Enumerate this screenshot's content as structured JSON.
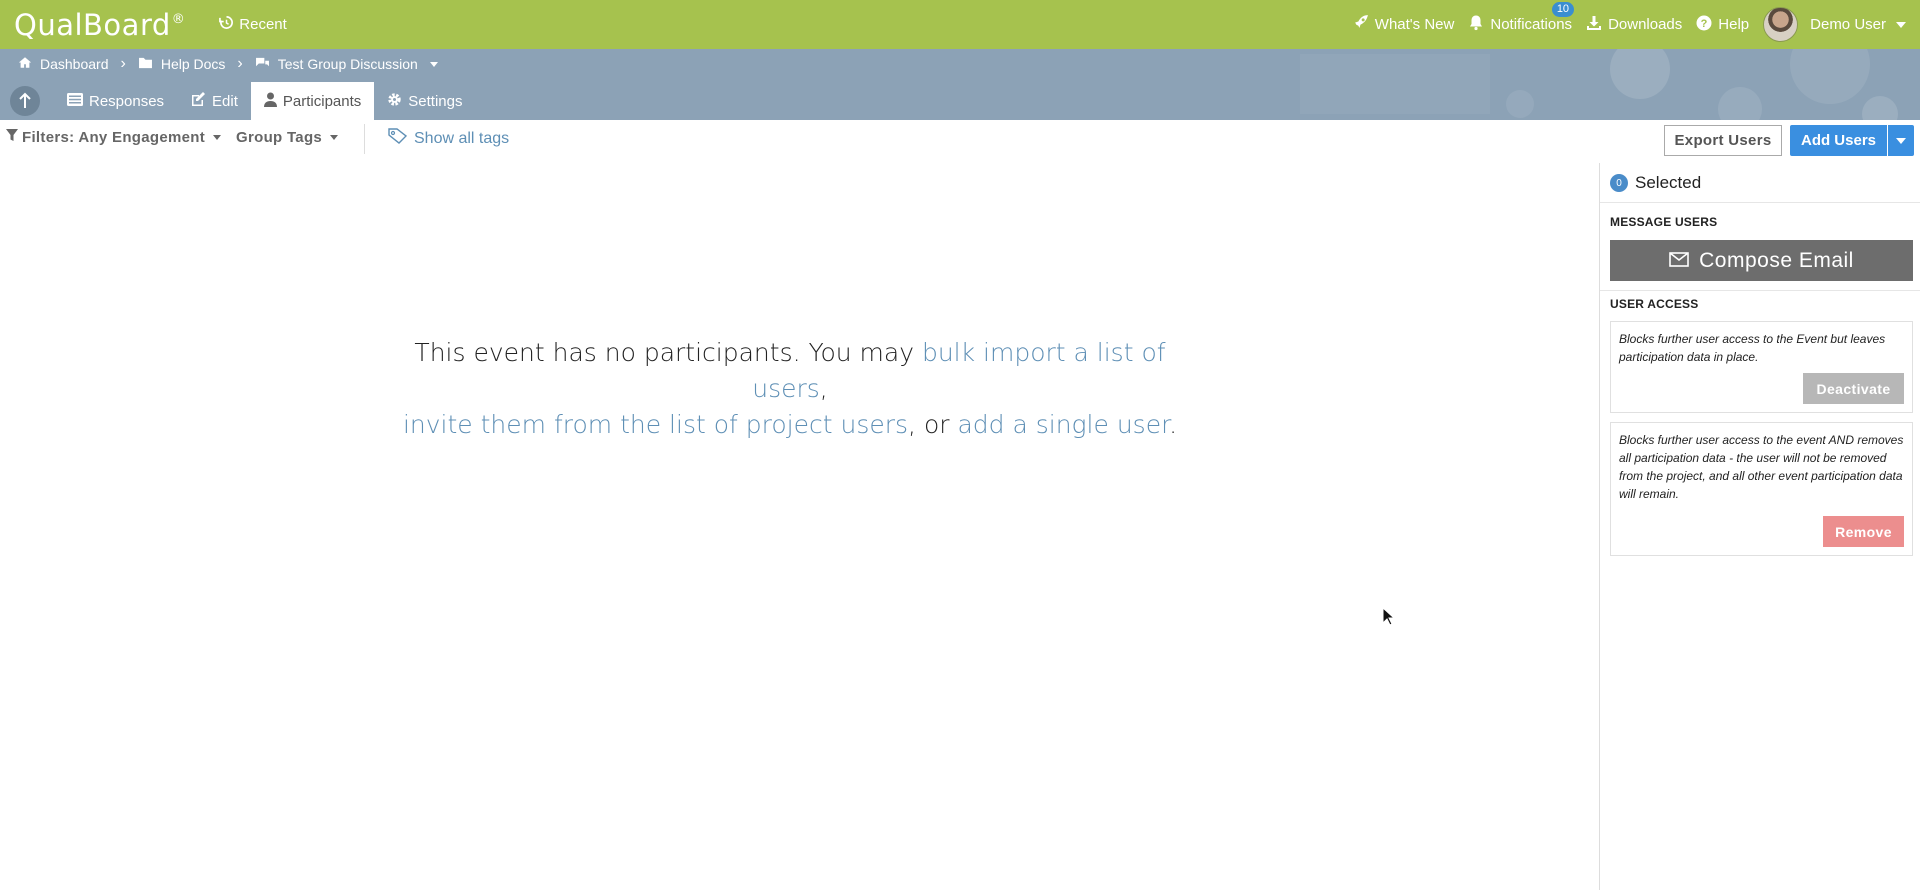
{
  "app": {
    "logo": "QualBoard",
    "logo_mark": "®",
    "recent": "Recent",
    "whats_new": "What's New",
    "notifications": "Notifications",
    "notifications_count": "10",
    "downloads": "Downloads",
    "help": "Help",
    "user": "Demo User"
  },
  "breadcrumb": {
    "items": [
      "Dashboard",
      "Help Docs",
      "Test Group Discussion"
    ]
  },
  "tabs": [
    {
      "label": "Responses",
      "icon": "list-icon",
      "active": false
    },
    {
      "label": "Edit",
      "icon": "edit-icon",
      "active": false
    },
    {
      "label": "Participants",
      "icon": "user-icon",
      "active": true
    },
    {
      "label": "Settings",
      "icon": "gear-icon",
      "active": false
    }
  ],
  "toolbar": {
    "filters_label": "Filters: Any Engagement",
    "group_tags": "Group Tags",
    "show_all_tags": "Show all tags",
    "export_users": "Export Users",
    "add_users": "Add Users"
  },
  "message": {
    "part1": "This event has no participants. You may ",
    "link1": "bulk import a list of users",
    "part2": ",",
    "link2": "invite them from the list of project users",
    "part3": ", or ",
    "link3": "add a single user",
    "part4": "."
  },
  "panel": {
    "selected_count": "0",
    "selected_label": "Selected",
    "message_users": "MESSAGE USERS",
    "compose_email": "Compose Email",
    "user_access": "USER ACCESS",
    "deactivate_desc": "Blocks further user access to the Event but leaves participation data in place.",
    "deactivate": "Deactivate",
    "remove_desc": "Blocks further user access to the event AND removes all participation data - the user will not be removed from the project, and all other event participation data will remain.",
    "remove": "Remove"
  },
  "colors": {
    "topbar": "#a6c24e",
    "subbar": "#8ca2b6",
    "link": "#5e8fb5",
    "primary_button": "#3a8fe0",
    "remove_button": "#ec8e8e"
  }
}
